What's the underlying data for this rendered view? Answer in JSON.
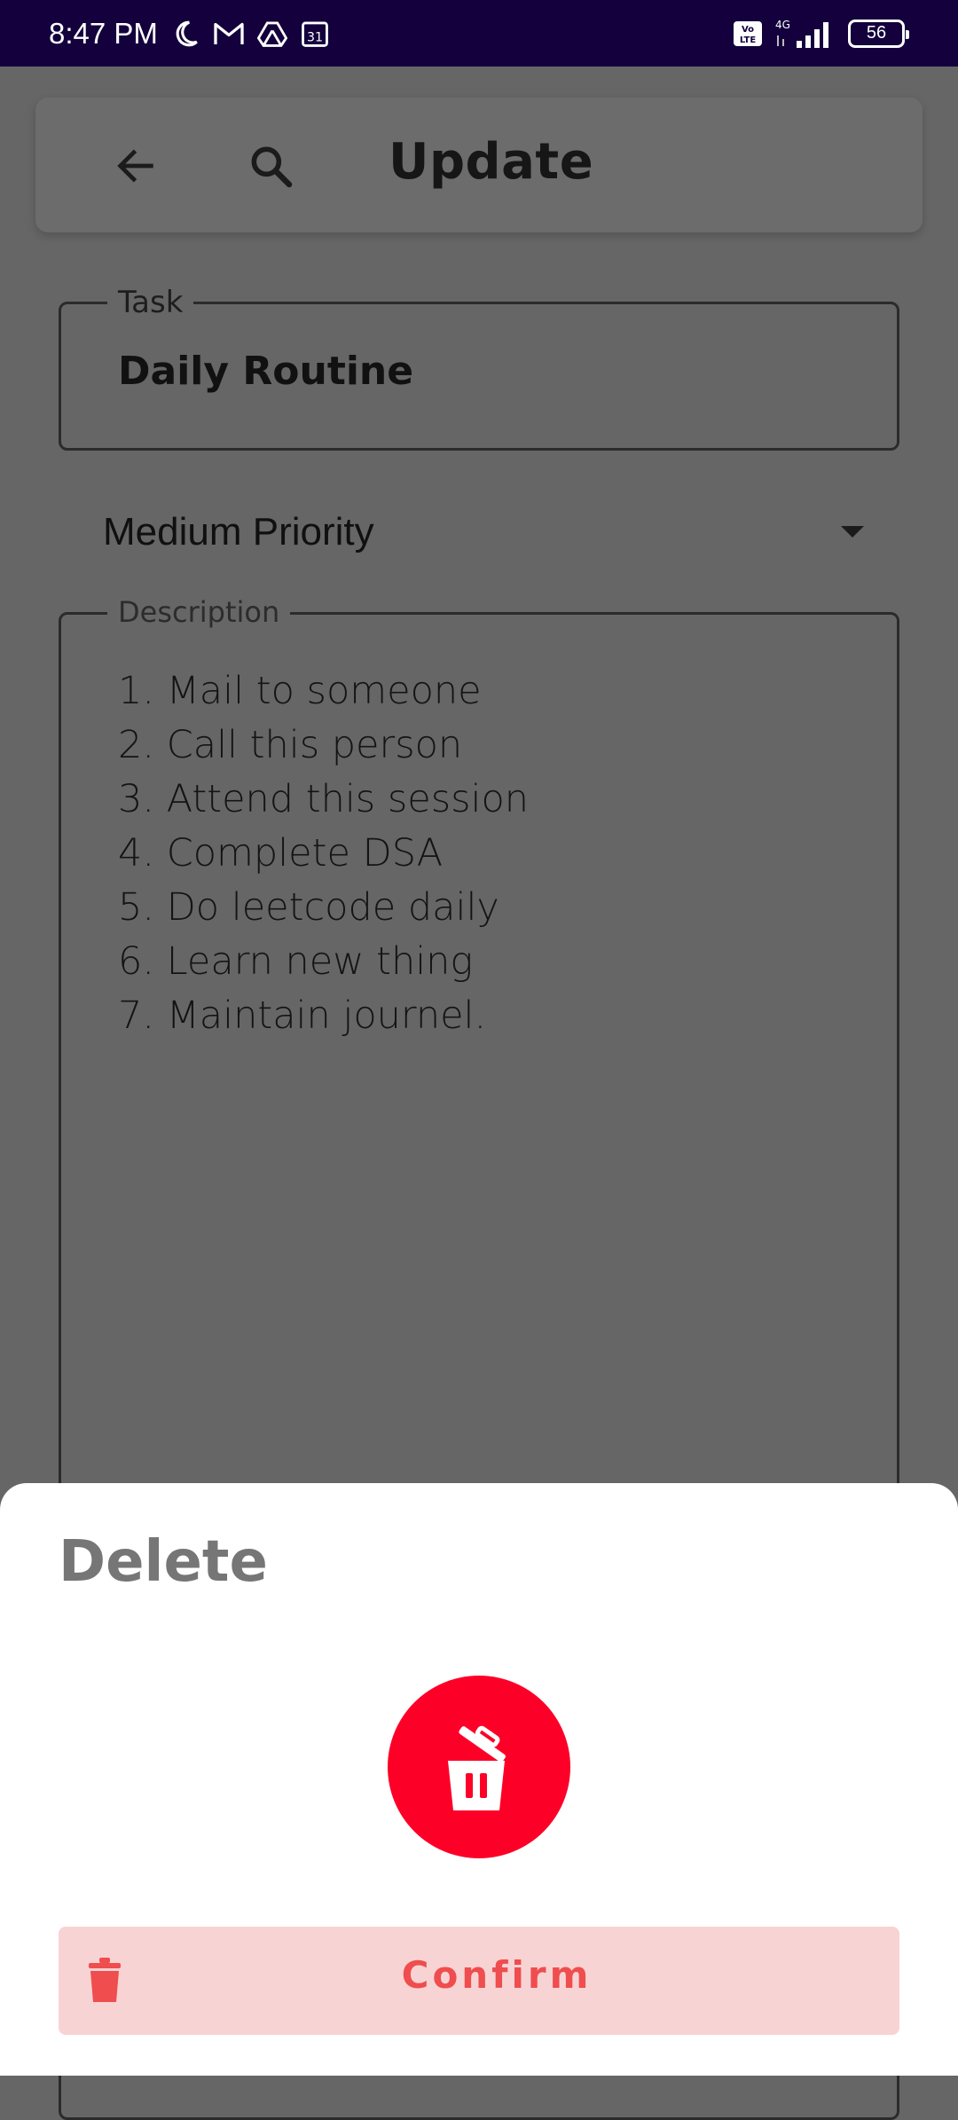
{
  "status_bar": {
    "time": "8:47 PM",
    "icons": [
      "moon-icon",
      "gmail-icon",
      "drive-icon",
      "calendar-icon"
    ],
    "calendar_day": "31",
    "network": "4G",
    "volte": "Vo LTE",
    "battery": "56"
  },
  "header": {
    "title": "Update",
    "back_icon": "arrow-left-icon",
    "search_icon": "search-icon"
  },
  "task": {
    "label": "Task",
    "value": "Daily Routine"
  },
  "priority": {
    "selected": "Medium Priority",
    "caret_icon": "caret-down-icon"
  },
  "description": {
    "label": "Description",
    "lines": [
      "1.  Mail to someone",
      "2. Call this person",
      "3. Attend this session",
      "4. Complete DSA",
      "5. Do leetcode daily",
      "6. Learn new thing",
      "7. Maintain journel."
    ]
  },
  "delete_sheet": {
    "title": "Delete",
    "icon": "trash-open-icon",
    "confirm_label": "Confirm",
    "confirm_icon": "trash-icon"
  },
  "colors": {
    "status_bar": "#13003c",
    "background_dim": "#666666",
    "accent_red": "#fd0027",
    "confirm_bg": "#f8d3d4",
    "confirm_text": "#ef4d4e"
  }
}
